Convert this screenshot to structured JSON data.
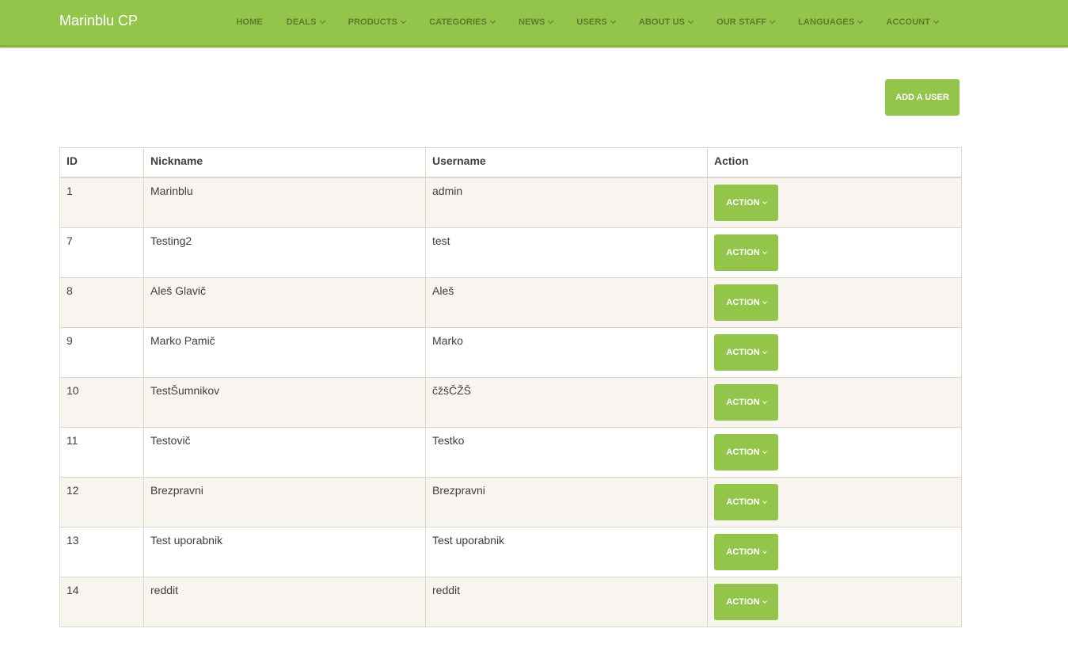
{
  "brand": "Marinblu CP",
  "nav": [
    {
      "label": "HOME",
      "dropdown": false
    },
    {
      "label": "DEALS",
      "dropdown": true
    },
    {
      "label": "PRODUCTS",
      "dropdown": true
    },
    {
      "label": "CATEGORIES",
      "dropdown": true
    },
    {
      "label": "NEWS",
      "dropdown": true
    },
    {
      "label": "USERS",
      "dropdown": true
    },
    {
      "label": "ABOUT US",
      "dropdown": true
    },
    {
      "label": "OUR STAFF",
      "dropdown": true
    },
    {
      "label": "LANGUAGES",
      "dropdown": true
    },
    {
      "label": "ACCOUNT",
      "dropdown": true
    }
  ],
  "add_user_label": "ADD A USER",
  "table": {
    "headers": [
      "ID",
      "Nickname",
      "Username",
      "Action"
    ],
    "action_label": "ACTION",
    "rows": [
      {
        "id": "1",
        "nickname": "Marinblu",
        "username": "admin"
      },
      {
        "id": "7",
        "nickname": "Testing2",
        "username": "test"
      },
      {
        "id": "8",
        "nickname": "Aleš Glavič",
        "username": "Aleš"
      },
      {
        "id": "9",
        "nickname": "Marko Pamič",
        "username": "Marko"
      },
      {
        "id": "10",
        "nickname": "TestŠumnikov",
        "username": "čžšČŽŠ"
      },
      {
        "id": "11",
        "nickname": "Testovič",
        "username": "Testko"
      },
      {
        "id": "12",
        "nickname": "Brezpravni",
        "username": "Brezpravni"
      },
      {
        "id": "13",
        "nickname": "Test uporabnik",
        "username": "Test uporabnik"
      },
      {
        "id": "14",
        "nickname": "reddit",
        "username": "reddit"
      }
    ]
  },
  "colors": {
    "accent": "#93c54b",
    "row_stripe": "#f8f5f0",
    "border": "#dfd7ca"
  }
}
